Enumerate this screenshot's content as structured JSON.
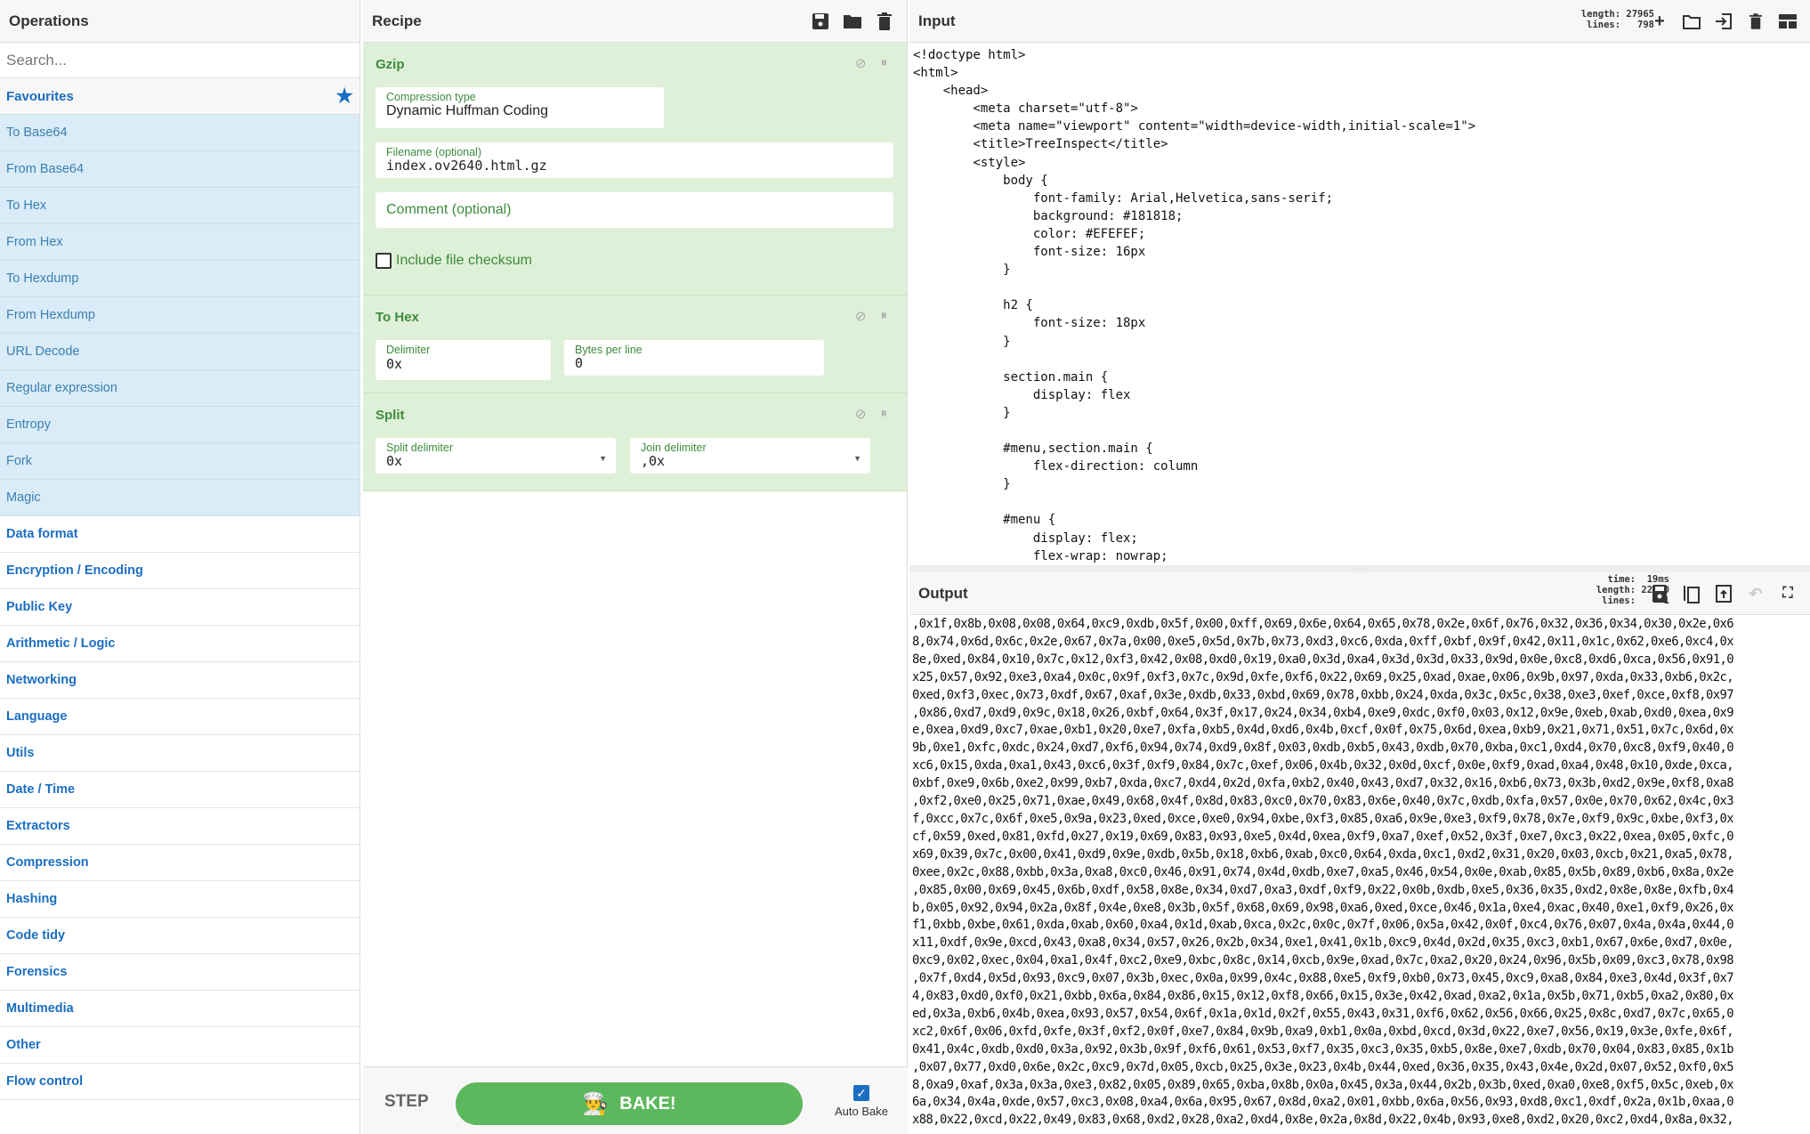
{
  "operations": {
    "title": "Operations",
    "search_placeholder": "Search...",
    "favourites_label": "Favourites",
    "favourites": [
      "To Base64",
      "From Base64",
      "To Hex",
      "From Hex",
      "To Hexdump",
      "From Hexdump",
      "URL Decode",
      "Regular expression",
      "Entropy",
      "Fork",
      "Magic"
    ],
    "categories": [
      "Data format",
      "Encryption / Encoding",
      "Public Key",
      "Arithmetic / Logic",
      "Networking",
      "Language",
      "Utils",
      "Date / Time",
      "Extractors",
      "Compression",
      "Hashing",
      "Code tidy",
      "Forensics",
      "Multimedia",
      "Other",
      "Flow control"
    ]
  },
  "recipe": {
    "title": "Recipe",
    "gzip": {
      "title": "Gzip",
      "compression_label": "Compression type",
      "compression_value": "Dynamic Huffman Coding",
      "filename_label": "Filename (optional)",
      "filename_value": "index.ov2640.html.gz",
      "comment_placeholder": "Comment (optional)",
      "checksum_label": "Include file checksum",
      "checksum_checked": false
    },
    "tohex": {
      "title": "To Hex",
      "delimiter_label": "Delimiter",
      "delimiter_value": "0x",
      "bpl_label": "Bytes per line",
      "bpl_value": "0"
    },
    "split": {
      "title": "Split",
      "split_label": "Split delimiter",
      "split_value": "0x",
      "join_label": "Join delimiter",
      "join_value": ",0x"
    },
    "step_label": "STEP",
    "bake_label": "BAKE!",
    "autobake_label": "Auto Bake",
    "autobake_checked": true
  },
  "input": {
    "title": "Input",
    "length": "length: 27965",
    "lines": "lines:   798",
    "text": "<!doctype html>\n<html>\n    <head>\n        <meta charset=\"utf-8\">\n        <meta name=\"viewport\" content=\"width=device-width,initial-scale=1\">\n        <title>TreeInspect</title>\n        <style>\n            body {\n                font-family: Arial,Helvetica,sans-serif;\n                background: #181818;\n                color: #EFEFEF;\n                font-size: 16px\n            }\n\n            h2 {\n                font-size: 18px\n            }\n\n            section.main {\n                display: flex\n            }\n\n            #menu,section.main {\n                flex-direction: column\n            }\n\n            #menu {\n                display: flex;\n                flex-wrap: nowrap;"
  },
  "output": {
    "title": "Output",
    "time": "time:  19ms",
    "length": "length: 22000",
    "lines": "lines:     1",
    "text_lines": [
      ",0x1f,0x8b,0x08,0x08,0x64,0xc9,0xdb,0x5f,0x00,0xff,0x69,0x6e,0x64,0x65,0x78,0x2e,0x6f,0x76,0x32,0x36,0x34,0x30,0x2e,0x6",
      "8,0x74,0x6d,0x6c,0x2e,0x67,0x7a,0x00,0xe5,0x5d,0x7b,0x73,0xd3,0xc6,0xda,0xff,0xbf,0x9f,0x42,0x11,0x1c,0x62,0xe6,0xc4,0x",
      "8e,0xed,0x84,0x10,0x7c,0x12,0xf3,0x42,0x08,0xd0,0x19,0xa0,0x3d,0xa4,0x3d,0x3d,0x33,0x9d,0x0e,0xc8,0xd6,0xca,0x56,0x91,0",
      "x25,0x57,0x92,0xe3,0xa4,0x0c,0x9f,0xf3,0x7c,0x9d,0xfe,0xf6,0x22,0x69,0x25,0xad,0xae,0x06,0x9b,0x97,0xda,0x33,0xb6,0x2c,",
      "0xed,0xf3,0xec,0x73,0xdf,0x67,0xaf,0x3e,0xdb,0x33,0xbd,0x69,0x78,0xbb,0x24,0xda,0x3c,0x5c,0x38,0xe3,0xef,0xce,0xf8,0x97",
      ",0x86,0xd7,0xd9,0x9c,0x18,0x26,0xbf,0x64,0x3f,0x17,0x24,0x34,0xb4,0xe9,0xdc,0xf0,0x03,0x12,0x9e,0xeb,0xab,0xd0,0xea,0x9",
      "e,0xea,0xd9,0xc7,0xae,0xb1,0x20,0xe7,0xfa,0xb5,0x4d,0xd6,0x4b,0xcf,0x0f,0x75,0x6d,0xea,0xb9,0x21,0x71,0x51,0x7c,0x6d,0x",
      "9b,0xe1,0xfc,0xdc,0x24,0xd7,0xf6,0x94,0x74,0xd9,0x8f,0x03,0xdb,0xb5,0x43,0xdb,0x70,0xba,0xc1,0xd4,0x70,0xc8,0xf9,0x40,0",
      "xc6,0x15,0xda,0xa1,0x43,0xc6,0x3f,0xf9,0x84,0x7c,0xef,0x06,0x4b,0x32,0x0d,0xcf,0x0e,0xf9,0xad,0xa4,0x48,0x10,0xde,0xca,",
      "0xbf,0xe9,0x6b,0xe2,0x99,0xb7,0xda,0xc7,0xd4,0x2d,0xfa,0xb2,0x40,0x43,0xd7,0x32,0x16,0xb6,0x73,0x3b,0xd2,0x9e,0xf8,0xa8",
      ",0xf2,0xe0,0x25,0x71,0xae,0x49,0x68,0x4f,0x8d,0x83,0xc0,0x70,0x83,0x6e,0x40,0x7c,0xdb,0xfa,0x57,0x0e,0x70,0x62,0x4c,0x3",
      "f,0xcc,0x7c,0x6f,0xe5,0x9a,0x23,0xed,0xce,0xe0,0x94,0xbe,0xf3,0x85,0xa6,0x9e,0xe3,0xf9,0x78,0x7e,0xf9,0x9c,0xbe,0xf3,0x",
      "cf,0x59,0xed,0x81,0xfd,0x27,0x19,0x69,0x83,0x93,0xe5,0x4d,0xea,0xf9,0xa7,0xef,0x52,0x3f,0xe7,0xc3,0x22,0xea,0x05,0xfc,0",
      "x69,0x39,0x7c,0x00,0x41,0xd9,0x9e,0xdb,0x5b,0x18,0xb6,0xab,0xc0,0x64,0xda,0xc1,0xd2,0x31,0x20,0x03,0xcb,0x21,0xa5,0x78,",
      "0xee,0x2c,0x88,0xbb,0x3a,0xa8,0xc0,0x46,0x91,0x74,0x4d,0xdb,0xe7,0xa5,0x46,0x54,0x0e,0xab,0x85,0x5b,0x89,0xb6,0x8a,0x2e",
      ",0x85,0x00,0x69,0x45,0x6b,0xdf,0x58,0x8e,0x34,0xd7,0xa3,0xdf,0xf9,0x22,0x0b,0xdb,0xe5,0x36,0x35,0xd2,0x8e,0x8e,0xfb,0x4",
      "b,0x05,0x92,0x94,0x2a,0x8f,0x4e,0xe8,0x3b,0x5f,0x68,0x69,0x98,0xa6,0xed,0xce,0x46,0x1a,0xe4,0xac,0x40,0xe1,0xf9,0x26,0x",
      "f1,0xbb,0xbe,0x61,0xda,0xab,0x60,0xa4,0x1d,0xab,0xca,0x2c,0x0c,0x7f,0x06,0x5a,0x42,0x0f,0xc4,0x76,0x07,0x4a,0x4a,0x44,0",
      "x11,0xdf,0x9e,0xcd,0x43,0xa8,0x34,0x57,0x26,0x2b,0x34,0xe1,0x41,0x1b,0xc9,0x4d,0x2d,0x35,0xc3,0xb1,0x67,0x6e,0xd7,0x0e,",
      "0xc9,0x02,0xec,0x04,0xa1,0x4f,0xc2,0xe9,0xbc,0x8c,0x14,0xcb,0x9e,0xad,0x7c,0xa2,0x20,0x24,0x96,0x5b,0x09,0xc3,0x78,0x98",
      ",0x7f,0xd4,0x5d,0x93,0xc9,0x07,0x3b,0xec,0x0a,0x99,0x4c,0x88,0xe5,0xf9,0xb0,0x73,0x45,0xc9,0xa8,0x84,0xe3,0x4d,0x3f,0x7",
      "4,0x83,0xd0,0xf0,0x21,0xbb,0x6a,0x84,0x86,0x15,0x12,0xf8,0x66,0x15,0x3e,0x42,0xad,0xa2,0x1a,0x5b,0x71,0xb5,0xa2,0x80,0x",
      "ed,0x3a,0xb6,0x4b,0xea,0x93,0x57,0x54,0x6f,0x1a,0x1d,0x2f,0x55,0x43,0x31,0xf6,0x62,0x56,0x66,0x25,0x8c,0xd7,0x7c,0x65,0",
      "xc2,0x6f,0x06,0xfd,0xfe,0x3f,0xf2,0x0f,0xe7,0x84,0x9b,0xa9,0xb1,0x0a,0xbd,0xcd,0x3d,0x22,0xe7,0x56,0x19,0x3e,0xfe,0x6f,",
      "0x41,0x4c,0xdb,0xd0,0x3a,0x92,0x3b,0x9f,0xf6,0x61,0x53,0xf7,0x35,0xc3,0x35,0xb5,0x8e,0xe7,0xdb,0x70,0x04,0x83,0x85,0x1b",
      ",0x07,0x77,0xd0,0x6e,0x2c,0xc9,0x7d,0x05,0xcb,0x25,0x3e,0x23,0x4b,0x44,0xed,0x36,0x35,0x43,0x4e,0x2d,0x07,0x52,0xf0,0x5",
      "8,0xa9,0xaf,0x3a,0x3a,0xe3,0x82,0x05,0x89,0x65,0xba,0x8b,0x0a,0x45,0x3a,0x44,0x2b,0x3b,0xed,0xa0,0xe8,0xf5,0x5c,0xeb,0x",
      "6a,0x34,0x4a,0xde,0x57,0xc3,0x08,0xa4,0x6a,0x95,0x67,0x8d,0xa2,0x01,0xbb,0x6a,0x56,0x93,0xd8,0xc1,0xdf,0x2a,0x1b,0xaa,0",
      "x88,0x22,0xcd,0x22,0x49,0x83,0x68,0xd2,0x28,0xa2,0xd4,0x8e,0x2a,0x8d,0x22,0x4b,0x93,0xe8,0xd2,0x20,0xc2,0xd4,0x8a,0x32,"
    ]
  },
  "colors": {
    "accent": "#1b6ec2",
    "recipe_bg": "#dff0d8",
    "recipe_text": "#3c8b3c",
    "bake": "#5cb85c",
    "favourite_bg": "#d9ecf7"
  }
}
